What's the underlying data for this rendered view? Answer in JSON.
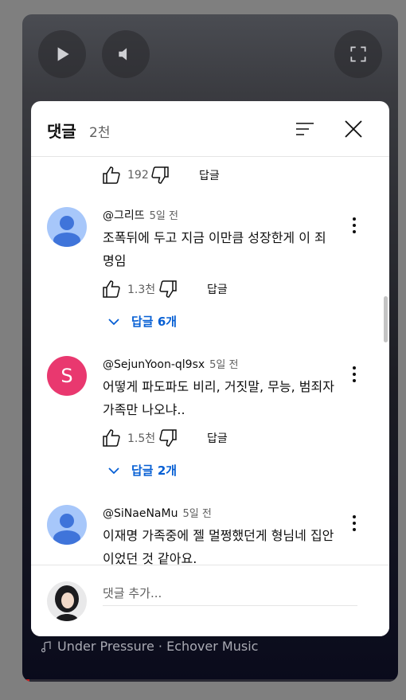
{
  "player": {
    "song": "Under Pressure · Echover Music"
  },
  "sheet": {
    "title": "댓글",
    "count": "2천"
  },
  "top_actions": {
    "likes": "192",
    "reply_label": "답글"
  },
  "comments": [
    {
      "author": "@그리뜨",
      "time": "5일 전",
      "text": "조폭뒤에 두고 지금 이만큼 성장한게 이 죄명임",
      "likes": "1.3천",
      "reply_label": "답글",
      "replies": "답글 6개",
      "avatar_initial": ""
    },
    {
      "author": "@SejunYoon-ql9sx",
      "time": "5일 전",
      "text": "어떻게 파도파도 비리, 거짓말, 무능, 범죄자 가족만 나오냐..",
      "likes": "1.5천",
      "reply_label": "답글",
      "replies": "답글 2개",
      "avatar_initial": "S"
    },
    {
      "author": "@SiNaeNaMu",
      "time": "5일 전",
      "text": "이재명 가족중에 젤 멀쩡했던게 형님네 집안이었던 것 같아요.",
      "avatar_initial": ""
    }
  ],
  "composer": {
    "placeholder": "댓글 추가..."
  },
  "colors": {
    "accent_blue": "#065fd4",
    "avatar_default_bg": "#a7c7fa",
    "avatar_default_fg": "#3f74da",
    "avatar_s_bg": "#e9386f"
  }
}
